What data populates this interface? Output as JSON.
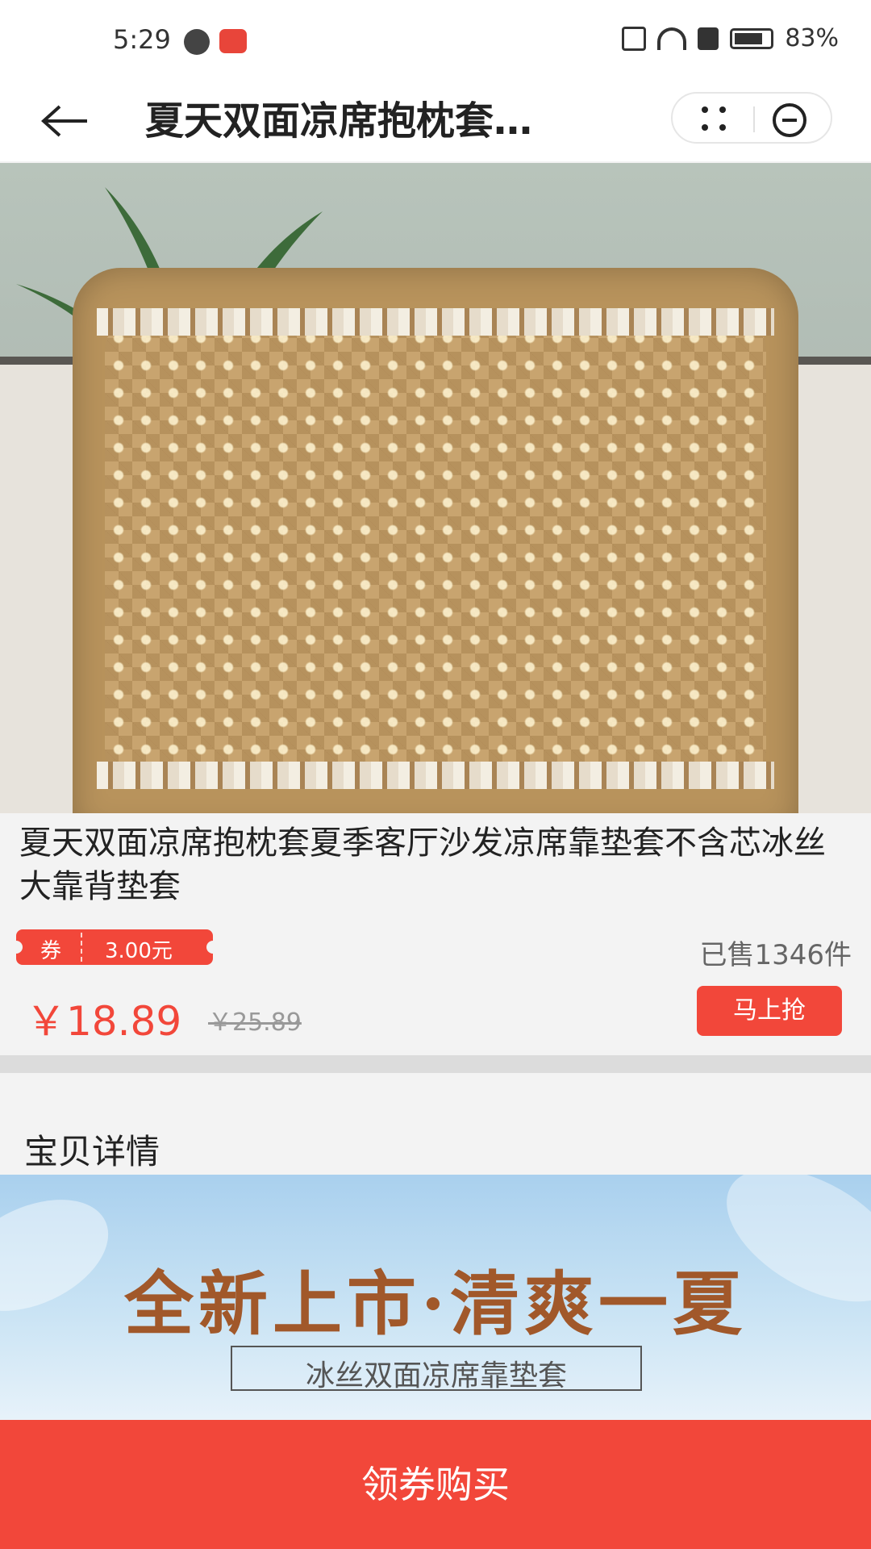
{
  "status_bar": {
    "time": "5:29",
    "battery": "83%"
  },
  "header": {
    "title": "夏天双面凉席抱枕套…",
    "back_icon": "arrow-left-icon",
    "more_icon": "more-dots-icon",
    "close_icon": "minus-circle-icon"
  },
  "product": {
    "title": "夏天双面凉席抱枕套夏季客厅沙发凉席靠垫套不含芯冰丝大靠背垫套",
    "coupon_label": "券",
    "coupon_value": "3.00元",
    "sold": "已售1346件",
    "price": "￥18.89",
    "original_price": "￥25.89",
    "grab_button": "马上抢"
  },
  "detail": {
    "section_title": "宝贝详情",
    "banner_headline": "全新上市·清爽一夏",
    "banner_subtitle": "冰丝双面凉席靠垫套"
  },
  "buy_button": "领券购买",
  "colors": {
    "accent": "#f2473a"
  }
}
